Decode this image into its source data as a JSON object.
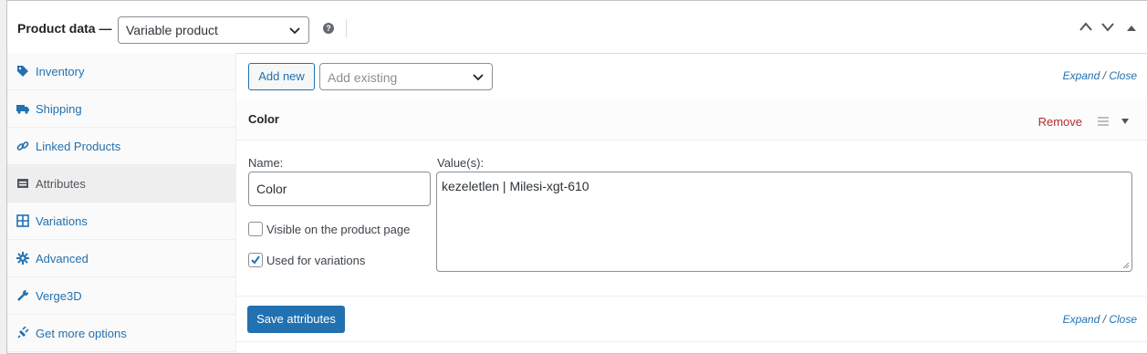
{
  "header": {
    "title": "Product data —",
    "product_type": "Variable product",
    "help_icon": "help-circle-icon"
  },
  "sidebar": {
    "items": [
      {
        "label": "Inventory",
        "icon": "tag-icon"
      },
      {
        "label": "Shipping",
        "icon": "truck-icon"
      },
      {
        "label": "Linked Products",
        "icon": "link-icon"
      },
      {
        "label": "Attributes",
        "icon": "list-icon",
        "active": true
      },
      {
        "label": "Variations",
        "icon": "grid-icon"
      },
      {
        "label": "Advanced",
        "icon": "gear-icon"
      },
      {
        "label": "Verge3D",
        "icon": "wrench-icon"
      },
      {
        "label": "Get more options",
        "icon": "plugin-icon"
      }
    ]
  },
  "toolbar": {
    "add_new": "Add new",
    "add_existing_placeholder": "Add existing",
    "expand": "Expand",
    "close": "Close",
    "slash": "/"
  },
  "attribute": {
    "name": "Color",
    "remove_label": "Remove",
    "name_label": "Name:",
    "name_value": "Color",
    "values_label": "Value(s):",
    "values_value": "kezeletlen | Milesi-xgt-610",
    "visible_label": "Visible on the product page",
    "visible_checked": false,
    "variations_label": "Used for variations",
    "variations_checked": true
  },
  "footer": {
    "save_label": "Save attributes",
    "expand": "Expand",
    "close": "Close",
    "slash": "/"
  },
  "colors": {
    "accent": "#2271b1",
    "danger": "#b32d2e"
  }
}
